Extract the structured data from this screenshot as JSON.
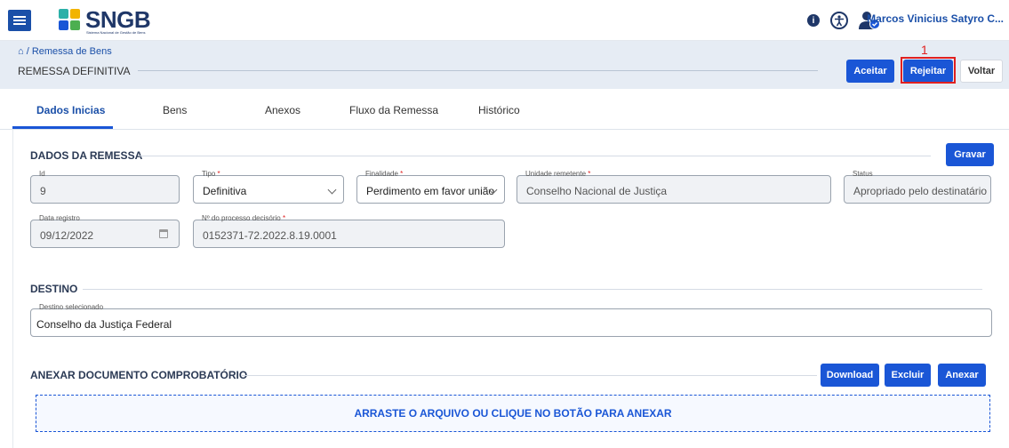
{
  "header": {
    "brand": "SNGB",
    "brand_sub": "Sistema Nacional de Gestão de Bens",
    "user_name": "Marcos Vinicius Satyro C...",
    "info_icon": "info-icon",
    "accessibility_icon": "accessibility-icon",
    "user_icon": "user-check-icon"
  },
  "page": {
    "breadcrumb": "/ Remessa de Bens",
    "title": "REMESSA DEFINITIVA",
    "actions": {
      "accept": "Aceitar",
      "reject": "Rejeitar",
      "back": "Voltar"
    },
    "annotation": "1"
  },
  "tabs": [
    {
      "label": "Dados Inicias",
      "active": true
    },
    {
      "label": "Bens"
    },
    {
      "label": "Anexos"
    },
    {
      "label": "Fluxo da Remessa"
    },
    {
      "label": "Histórico"
    }
  ],
  "remessa": {
    "section_title": "DADOS DA REMESSA",
    "save_label": "Gravar",
    "id": {
      "label": "Id",
      "value": "9"
    },
    "tipo": {
      "label": "Tipo",
      "required": "*",
      "value": "Definitiva"
    },
    "finalidade": {
      "label": "Finalidade",
      "required": "*",
      "value": "Perdimento em favor união"
    },
    "unidade": {
      "label": "Unidade remetente",
      "required": "*",
      "value": "Conselho Nacional de Justiça"
    },
    "status": {
      "label": "Status",
      "value": "Apropriado pelo destinatário"
    },
    "data_registro": {
      "label": "Data registro",
      "value": "09/12/2022"
    },
    "processo": {
      "label": "Nº do processo decisório",
      "required": "*",
      "value": "0152371-72.2022.8.19.0001"
    }
  },
  "destino": {
    "section_title": "DESTINO",
    "label": "Destino selecionado",
    "value": "Conselho da Justiça Federal"
  },
  "anexar": {
    "section_title": "ANEXAR DOCUMENTO COMPROBATÓRIO",
    "download": "Download",
    "delete": "Excluir",
    "attach": "Anexar",
    "dropzone": "ARRASTE O ARQUIVO OU CLIQUE NO BOTÃO PARA ANEXAR"
  },
  "colors": {
    "primary": "#1a56d6",
    "navy": "#1f3768",
    "annotation": "#e02020"
  }
}
